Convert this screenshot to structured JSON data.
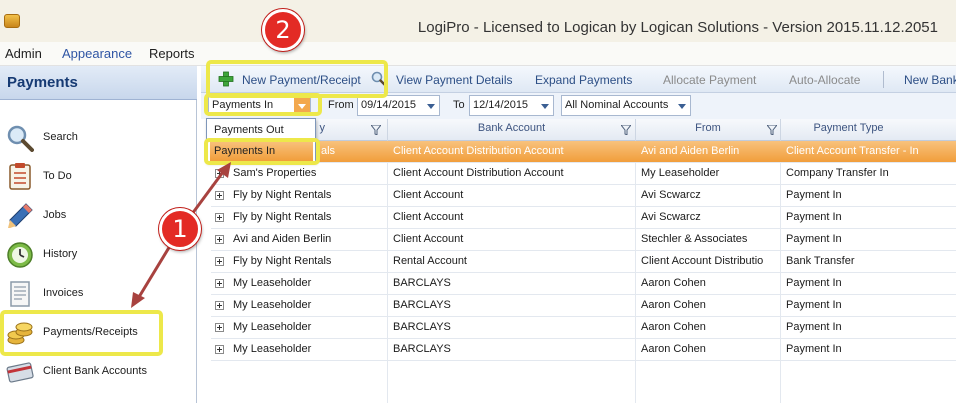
{
  "window": {
    "title": "LogiPro - Licensed to Logican by Logican Solutions - Version 2015.11.12.2051",
    "icon": "app-icon"
  },
  "menu": [
    "Admin",
    "Appearance",
    "Reports"
  ],
  "sidebar": {
    "title": "Payments",
    "items": [
      {
        "label": "Search",
        "icon": "magnifier-icon"
      },
      {
        "label": "To Do",
        "icon": "checklist-icon"
      },
      {
        "label": "Jobs",
        "icon": "pencil-icon"
      },
      {
        "label": "History",
        "icon": "clock-icon"
      },
      {
        "label": "Invoices",
        "icon": "invoice-icon"
      },
      {
        "label": "Payments/Receipts",
        "icon": "coins-icon"
      },
      {
        "label": "Client Bank Accounts",
        "icon": "bank-card-icon"
      }
    ]
  },
  "toolbar": {
    "new_payment": "New Payment/Receipt",
    "view_details": "View Payment Details",
    "expand": "Expand Payments",
    "allocate": "Allocate Payment",
    "auto_allocate": "Auto-Allocate",
    "new_bank": "New Bank"
  },
  "filters": {
    "direction": "Payments In",
    "from_label": "From",
    "from_date": "09/14/2015",
    "to_label": "To",
    "to_date": "12/14/2015",
    "nominal": "All Nominal Accounts"
  },
  "dropdown": {
    "options": [
      "Payments Out",
      "Payments In"
    ],
    "selected": "Payments In"
  },
  "grid": {
    "columns": [
      "y",
      "Bank Account",
      "From",
      "Payment Type"
    ],
    "rows": [
      {
        "payer": "als",
        "bank": "Client Account Distribution Account",
        "from": "Avi and Aiden Berlin",
        "type": "Client Account Transfer - In"
      },
      {
        "payer": "Sam's Properties",
        "bank": "Client Account Distribution Account",
        "from": "My Leaseholder",
        "type": "Company Transfer In"
      },
      {
        "payer": "Fly by Night Rentals",
        "bank": "Client Account",
        "from": "Avi Scwarcz",
        "type": "Payment In"
      },
      {
        "payer": "Fly by Night Rentals",
        "bank": "Client Account",
        "from": "Avi Scwarcz",
        "type": "Payment In"
      },
      {
        "payer": "Avi and Aiden Berlin",
        "bank": "Client Account",
        "from": "Stechler & Associates",
        "type": "Payment In"
      },
      {
        "payer": "Fly by Night Rentals",
        "bank": "Rental Account",
        "from": "Client Account Distributio",
        "type": "Bank Transfer"
      },
      {
        "payer": "My Leaseholder",
        "bank": "BARCLAYS",
        "from": "Aaron Cohen",
        "type": "Payment In"
      },
      {
        "payer": "My Leaseholder",
        "bank": "BARCLAYS",
        "from": "Aaron Cohen",
        "type": "Payment In"
      },
      {
        "payer": "My Leaseholder",
        "bank": "BARCLAYS",
        "from": "Aaron Cohen",
        "type": "Payment In"
      },
      {
        "payer": "My Leaseholder",
        "bank": "BARCLAYS",
        "from": "Aaron Cohen",
        "type": "Payment In"
      }
    ]
  },
  "annotations": {
    "step1": "1",
    "step2": "2",
    "highlight_color": "#ede84a",
    "callout_color": "#e32b25",
    "arrow_color": "#a8423f"
  },
  "colors": {
    "selection": "#f19e3b",
    "accent": "#2d4f86"
  }
}
